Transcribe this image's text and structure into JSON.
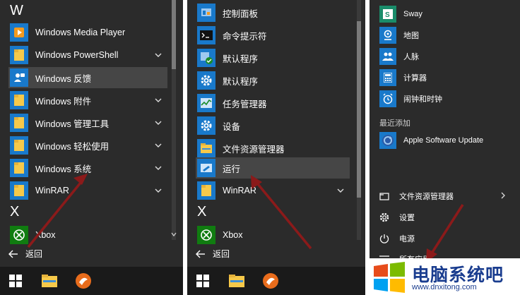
{
  "panel1": {
    "letter_w": "W",
    "letter_x": "X",
    "items": [
      {
        "label": "Windows Media Player"
      },
      {
        "label": "Windows PowerShell"
      },
      {
        "label": "Windows 反馈"
      },
      {
        "label": "Windows 附件"
      },
      {
        "label": "Windows 管理工具"
      },
      {
        "label": "Windows 轻松使用"
      },
      {
        "label": "Windows 系统"
      },
      {
        "label": "WinRAR"
      }
    ],
    "xbox": "Xbox",
    "back": "返回"
  },
  "panel2": {
    "items": [
      {
        "label": "控制面板"
      },
      {
        "label": "命令提示符"
      },
      {
        "label": "默认程序"
      },
      {
        "label": "默认程序"
      },
      {
        "label": "任务管理器"
      },
      {
        "label": "设备"
      },
      {
        "label": "文件资源管理器"
      },
      {
        "label": "运行"
      }
    ],
    "winrar": "WinRAR",
    "letter_x": "X",
    "xbox": "Xbox",
    "back": "返回"
  },
  "panel3": {
    "apps": [
      {
        "label": "Sway"
      },
      {
        "label": "地图"
      },
      {
        "label": "人脉"
      },
      {
        "label": "计算器"
      },
      {
        "label": "闹钟和时钟"
      }
    ],
    "recent_title": "最近添加",
    "recent_app": "Apple Software Update",
    "system": {
      "explorer": "文件资源管理器",
      "settings": "设置",
      "power": "电源",
      "all_apps": "所有应用"
    }
  },
  "watermark": {
    "title": "电脑系统吧",
    "url": "www.dnxitong.com"
  },
  "colors": {
    "panel_bg": "#2b2b2b",
    "tile_blue": "#1979ca",
    "folder_yellow": "#f6c94a",
    "xbox_green": "#107c10",
    "highlight": "#464646",
    "arrow_red": "#8b1a1a"
  }
}
